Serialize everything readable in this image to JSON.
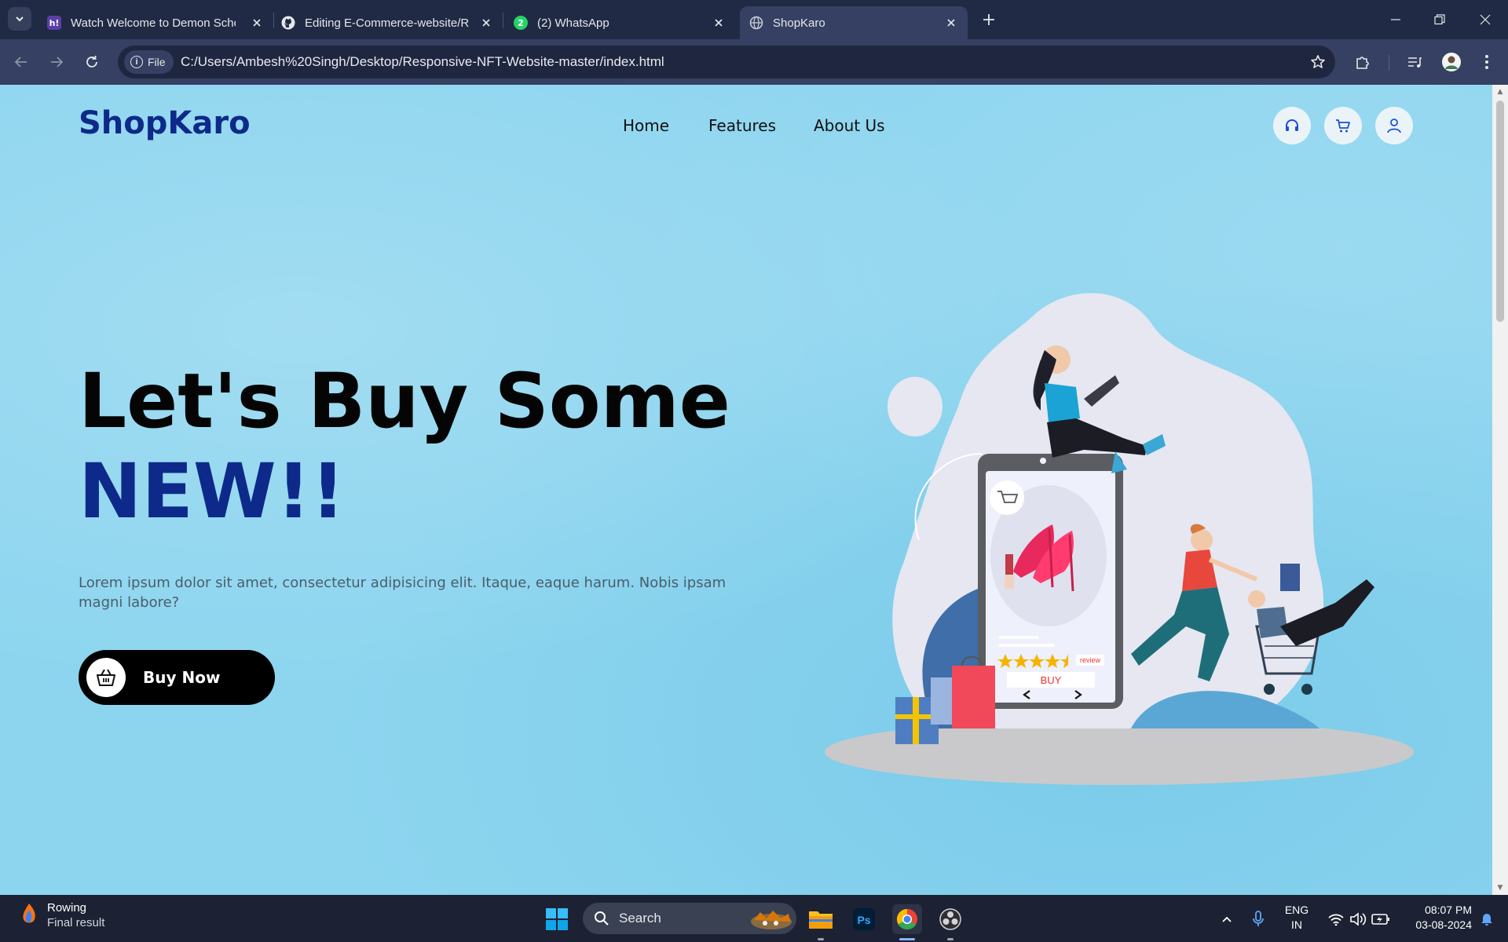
{
  "browser": {
    "tabs": [
      {
        "label": "Watch Welcome to Demon School",
        "favicon": "h!"
      },
      {
        "label": "Editing E-Commerce-website/README",
        "favicon": "github"
      },
      {
        "label": "(2) WhatsApp",
        "favicon": "whatsapp",
        "badge": "2"
      },
      {
        "label": "ShopKaro",
        "favicon": "globe",
        "active": true
      }
    ],
    "site_chip": "File",
    "url": "C:/Users/Ambesh%20Singh/Desktop/Responsive-NFT-Website-master/index.html"
  },
  "page": {
    "logo": "ShopKaro",
    "nav": [
      "Home",
      "Features",
      "About Us"
    ],
    "hero_line1": "Let's Buy Some",
    "hero_line2": "NEW!!",
    "hero_text": "Lorem ipsum dolor sit amet, consectetur adipisicing elit. Itaque, eaque harum. Nobis ipsam magni labore?",
    "cta": "Buy Now",
    "illustration": {
      "buy_label": "BUY",
      "review_label": "review",
      "rating": 4.5
    }
  },
  "taskbar": {
    "widget_title": "Rowing",
    "widget_sub": "Final result",
    "search": "Search",
    "lang1": "ENG",
    "lang2": "IN",
    "time": "08:07 PM",
    "date": "03-08-2024"
  },
  "colors": {
    "brand": "#0d2a8a",
    "page_bg": "#8dd5ef",
    "chrome_dark": "#202a44"
  }
}
